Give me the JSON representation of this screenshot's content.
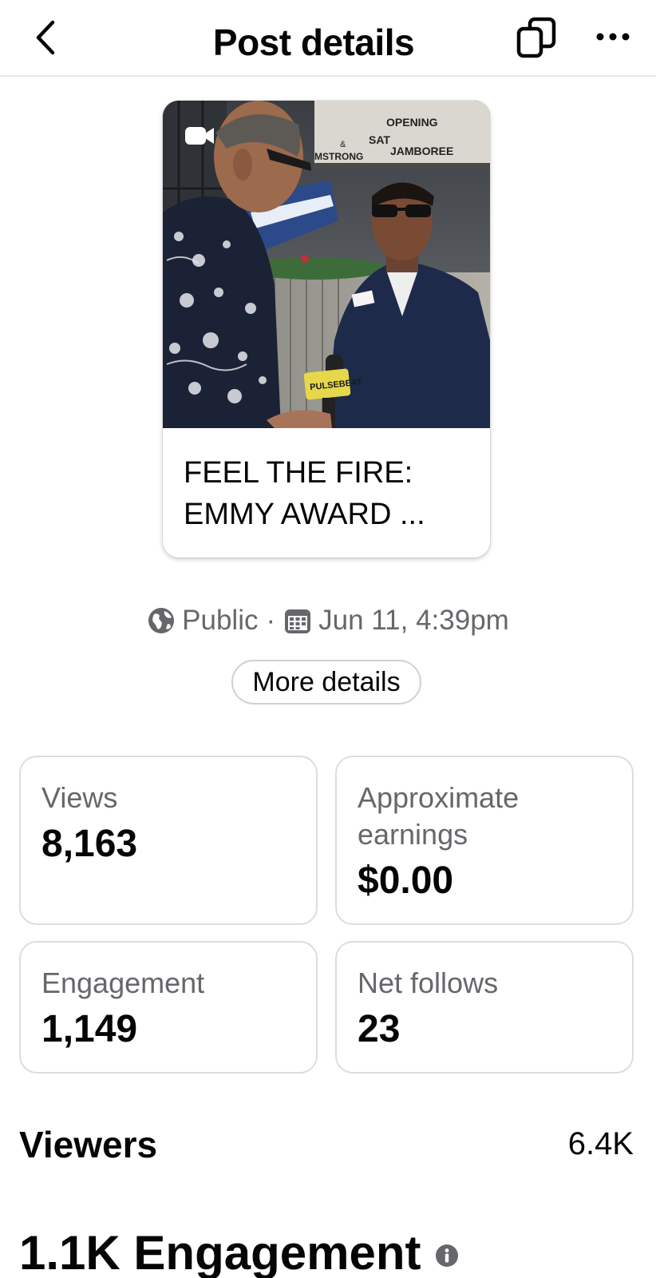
{
  "header": {
    "title": "Post details",
    "back_icon": "chevron-left-icon",
    "copy_icon": "copy-icon",
    "more_icon": "more-horizontal-icon"
  },
  "post": {
    "title": "FEEL THE FIRE: EMMY AWARD ...",
    "thumbnail": {
      "sign_line1": "OPENING",
      "sign_line2": "SAT",
      "sign_line3": "&",
      "sign_line4": "MSTRONG",
      "sign_line5": "JAMBOREE",
      "mic_label": "PULSEBEAT"
    },
    "video_icon": "video-camera-icon"
  },
  "meta": {
    "visibility": "Public",
    "separator": "·",
    "date": "Jun 11, 4:39pm",
    "globe_icon": "globe-icon",
    "calendar_icon": "calendar-icon"
  },
  "more_details_label": "More details",
  "stats": {
    "views": {
      "label": "Views",
      "value": "8,163"
    },
    "earnings": {
      "label": "Approximate earnings",
      "value": "$0.00"
    },
    "engagement": {
      "label": "Engagement",
      "value": "1,149"
    },
    "net_follows": {
      "label": "Net follows",
      "value": "23"
    }
  },
  "viewers": {
    "label": "Viewers",
    "value": "6.4K"
  },
  "engagement_section": {
    "heading": "1.1K Engagement",
    "info_icon": "info-icon"
  }
}
